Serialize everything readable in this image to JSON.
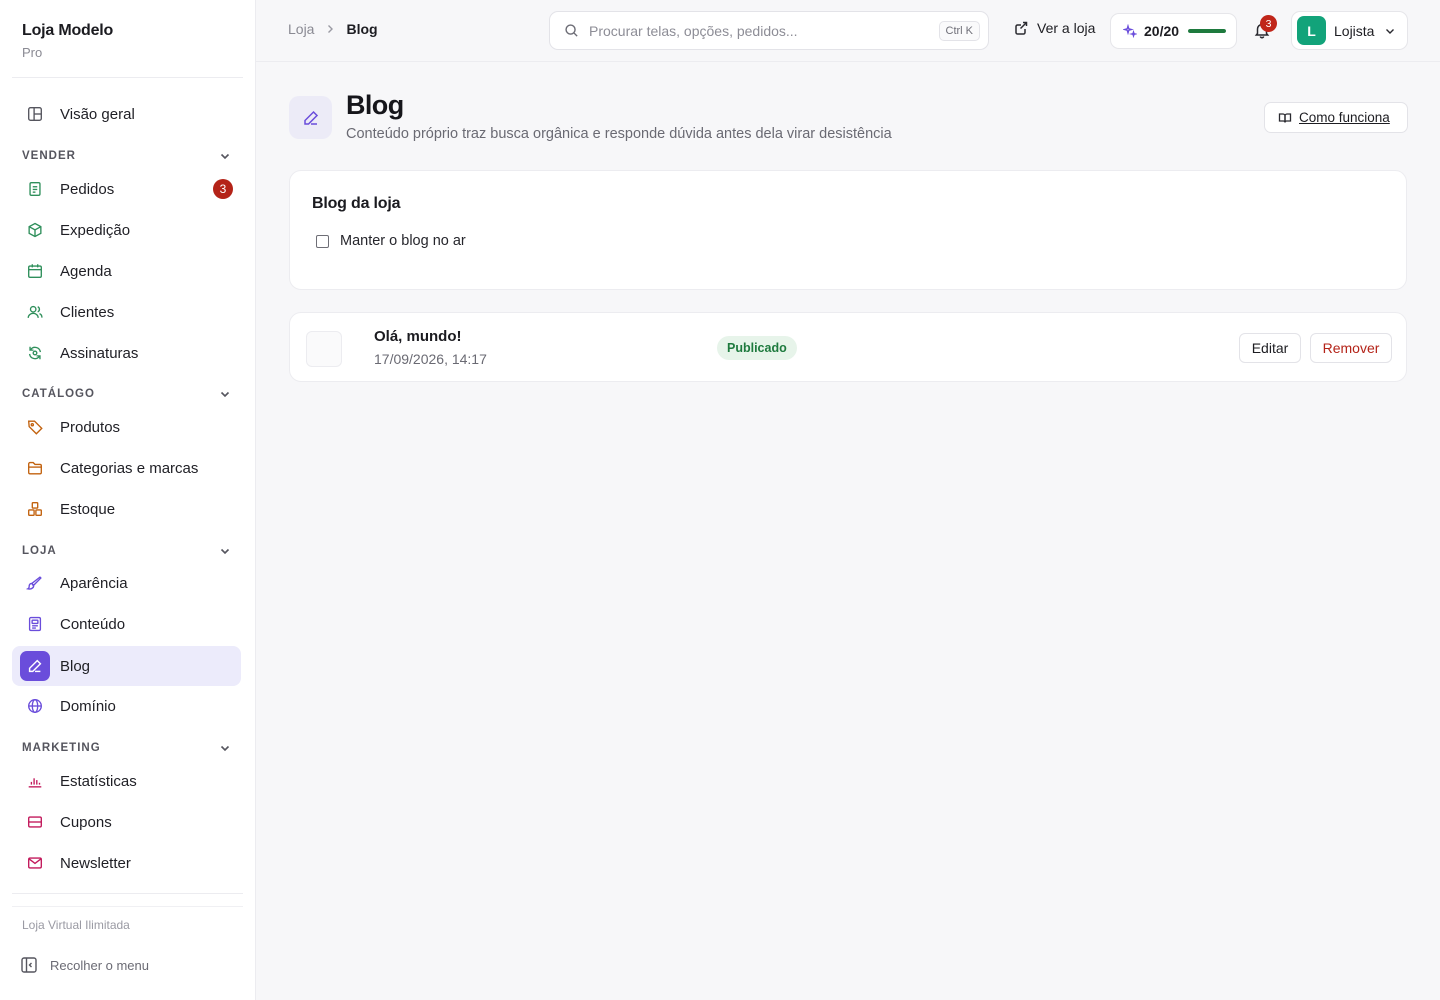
{
  "brand": {
    "name": "Loja Modelo",
    "plan": "Pro"
  },
  "sidebar": {
    "overview": {
      "label": "Visão geral",
      "icon": "layout-icon"
    },
    "sections": {
      "vender": {
        "label": "VENDER"
      },
      "catalogo": {
        "label": "CATÁLOGO"
      },
      "loja": {
        "label": "LOJA"
      },
      "marketing": {
        "label": "MARKETING"
      }
    },
    "items": {
      "pedidos": {
        "label": "Pedidos",
        "badge": "3",
        "icon": "receipt-icon",
        "color": "#2f8f5b"
      },
      "expedicao": {
        "label": "Expedição",
        "icon": "box-icon",
        "color": "#2f8f5b"
      },
      "agenda": {
        "label": "Agenda",
        "icon": "calendar-icon",
        "color": "#2f8f5b"
      },
      "clientes": {
        "label": "Clientes",
        "icon": "users-icon",
        "color": "#2f8f5b"
      },
      "assinaturas": {
        "label": "Assinaturas",
        "icon": "refresh-icon",
        "color": "#2f8f5b"
      },
      "produtos": {
        "label": "Produtos",
        "icon": "tag-icon",
        "color": "#c2620f"
      },
      "categorias": {
        "label": "Categorias e marcas",
        "icon": "folder-icon",
        "color": "#c2620f"
      },
      "estoque": {
        "label": "Estoque",
        "icon": "boxes-icon",
        "color": "#c2620f"
      },
      "aparencia": {
        "label": "Aparência",
        "icon": "brush-icon",
        "color": "#6a4ddb"
      },
      "conteudo": {
        "label": "Conteúdo",
        "icon": "document-icon",
        "color": "#6a4ddb"
      },
      "blog": {
        "label": "Blog",
        "icon": "pen-icon",
        "color": "#6a4ddb",
        "active": true
      },
      "dominio": {
        "label": "Domínio",
        "icon": "globe-icon",
        "color": "#6a4ddb"
      },
      "estatisticas": {
        "label": "Estatísticas",
        "icon": "bar-chart-icon",
        "color": "#c2185b"
      },
      "cupons": {
        "label": "Cupons",
        "icon": "ticket-icon",
        "color": "#c2185b"
      },
      "newsletter": {
        "label": "Newsletter",
        "icon": "mail-icon",
        "color": "#c2185b"
      }
    },
    "footer": {
      "plan_note": "Loja Virtual Ilimitada",
      "collapse_label": "Recolher o menu"
    }
  },
  "topbar": {
    "breadcrumb": [
      "Loja",
      "Blog"
    ],
    "search": {
      "placeholder": "Procurar telas, opções, pedidos...",
      "shortcut": "Ctrl K"
    },
    "view_store": "Ver a loja",
    "progress": {
      "label": "20/20",
      "fraction": 1.0,
      "color": "#1e7a3e"
    },
    "notifications": {
      "count": "3"
    },
    "user": {
      "initial": "L",
      "name": "Lojista",
      "avatar_color": "#12a37a"
    }
  },
  "header": {
    "title": "Blog",
    "subtitle": "Conteúdo próprio traz busca orgânica e responde dúvida antes dela virar desistência",
    "help_button": "Como funciona"
  },
  "blog_settings": {
    "title": "Blog da loja",
    "checkbox_label": "Manter o blog no ar",
    "checked": false
  },
  "posts": [
    {
      "title": "Olá, mundo!",
      "date": "17/09/2026, 14:17",
      "status": "Publicado",
      "edit_label": "Editar",
      "remove_label": "Remover"
    }
  ],
  "colors": {
    "accent": "#6a4ddb",
    "danger": "#b42318",
    "success": "#1e7a3e"
  }
}
